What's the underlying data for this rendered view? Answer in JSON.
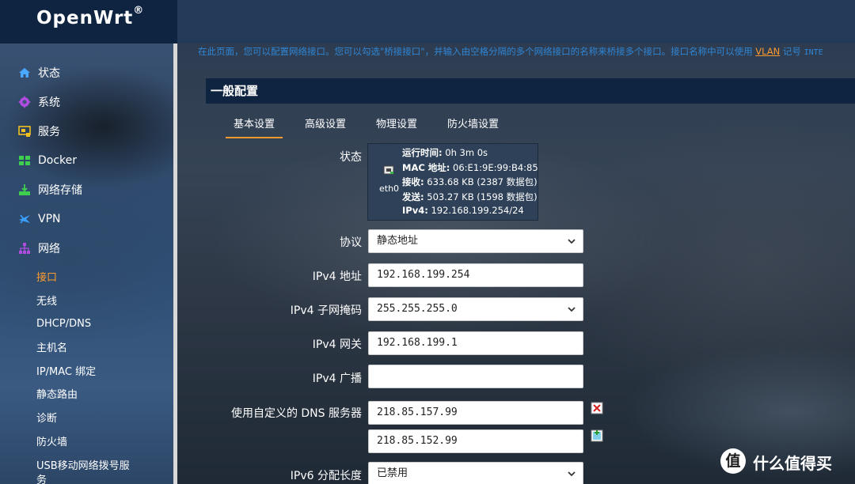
{
  "app": {
    "logo": "OpenWrt",
    "logo_mark": "®"
  },
  "sidebar": {
    "items": [
      {
        "label": "状态",
        "icon": "home-icon"
      },
      {
        "label": "系统",
        "icon": "gear-icon"
      },
      {
        "label": "服务",
        "icon": "services-icon"
      },
      {
        "label": "Docker",
        "icon": "docker-icon"
      },
      {
        "label": "网络存储",
        "icon": "storage-icon"
      },
      {
        "label": "VPN",
        "icon": "vpn-icon"
      },
      {
        "label": "网络",
        "icon": "network-icon"
      }
    ],
    "sub_items": [
      {
        "label": "接口",
        "active": true
      },
      {
        "label": "无线"
      },
      {
        "label": "DHCP/DNS"
      },
      {
        "label": "主机名"
      },
      {
        "label": "IP/MAC 绑定"
      },
      {
        "label": "静态路由"
      },
      {
        "label": "诊断"
      },
      {
        "label": "防火墙"
      },
      {
        "label": "USB移动网络拨号服"
      },
      {
        "label": "务"
      }
    ]
  },
  "notice": {
    "text": "在此页面，您可以配置网络接口。您可以勾选\"桥接接口\"，并输入由空格分隔的多个网络接口的名称来桥接多个接口。接口名称中可以使用 ",
    "vlan": "VLAN",
    "text2": " 记号 ",
    "tail": "INTE"
  },
  "panel": {
    "title": "一般配置",
    "tabs": [
      "基本设置",
      "高级设置",
      "物理设置",
      "防火墙设置"
    ],
    "active_tab": 0
  },
  "form": {
    "status_label": "状态",
    "status": {
      "iface": "eth0",
      "uptime_key": "运行时间:",
      "uptime": "0h 3m 0s",
      "mac_key": "MAC 地址:",
      "mac": "06:E1:9E:99:B4:85",
      "rx_key": "接收:",
      "rx": "633.68 KB (2387 数据包)",
      "tx_key": "发送:",
      "tx": "503.27 KB (1598 数据包)",
      "ipv4_key": "IPv4:",
      "ipv4": "192.168.199.254/24"
    },
    "protocol_label": "协议",
    "protocol": "静态地址",
    "ipv4_addr_label": "IPv4 地址",
    "ipv4_addr": "192.168.199.254",
    "netmask_label": "IPv4 子网掩码",
    "netmask": "255.255.255.0",
    "gateway_label": "IPv4 网关",
    "gateway": "192.168.199.1",
    "broadcast_label": "IPv4 广播",
    "broadcast": "",
    "dns_label": "使用自定义的 DNS 服务器",
    "dns": [
      "218.85.157.99",
      "218.85.152.99"
    ],
    "ipv6_label": "IPv6 分配长度",
    "ipv6": "已禁用"
  },
  "watermark": {
    "logo": "值",
    "text": "什么值得买"
  },
  "colors": {
    "accent": "#ff9a2e",
    "link": "#2f86d6",
    "header": "#0e2440"
  }
}
